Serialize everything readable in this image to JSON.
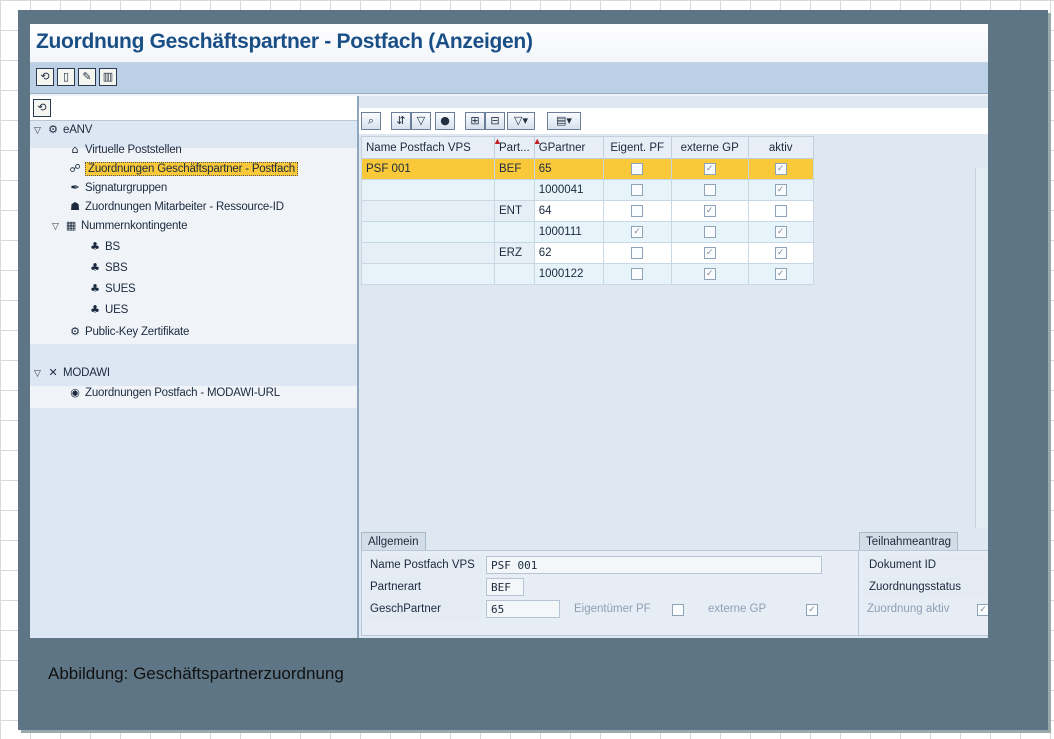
{
  "window": {
    "title": "Zuordnung Geschäftspartner - Postfach (Anzeigen)"
  },
  "caption": "Abbildung: Geschäftspartnerzuordnung",
  "tree": {
    "root": "eANV",
    "items": [
      "Virtuelle Poststellen",
      "Zuordnungen Geschäftspartner - Postfach",
      "Signaturgruppen",
      "Zuordnungen Mitarbeiter - Ressource-ID",
      "Nummernkontingente",
      "BS",
      "SBS",
      "SUES",
      "UES",
      "Public-Key Zertifikate"
    ],
    "root2": "MODAWI",
    "items2": [
      "Zuordnungen Postfach - MODAWI-URL"
    ]
  },
  "grid": {
    "columns": [
      "Name Postfach VPS",
      "Part...",
      "GPartner",
      "Eigent. PF",
      "externe GP",
      "aktiv"
    ],
    "rows": [
      {
        "postfach": "PSF 001",
        "part": "BEF",
        "gpartner": "65",
        "eigent": false,
        "extern": true,
        "aktiv": true
      },
      {
        "postfach": "",
        "part": "",
        "gpartner": "1000041",
        "eigent": false,
        "extern": false,
        "aktiv": true
      },
      {
        "postfach": "",
        "part": "ENT",
        "gpartner": "64",
        "eigent": false,
        "extern": true,
        "aktiv": false
      },
      {
        "postfach": "",
        "part": "",
        "gpartner": "1000111",
        "eigent": true,
        "extern": false,
        "aktiv": true
      },
      {
        "postfach": "",
        "part": "ERZ",
        "gpartner": "62",
        "eigent": false,
        "extern": true,
        "aktiv": true
      },
      {
        "postfach": "",
        "part": "",
        "gpartner": "1000122",
        "eigent": false,
        "extern": true,
        "aktiv": true
      }
    ]
  },
  "detail": {
    "tab": "Allgemein",
    "name_postfach_label": "Name Postfach VPS",
    "name_postfach_value": "PSF 001",
    "partnerart_label": "Partnerart",
    "partnerart_value": "BEF",
    "geschpartner_label": "GeschPartner",
    "geschpartner_value": "65",
    "eigentuemer_label": "Eigentümer PF",
    "extern_label": "externe GP"
  },
  "teilnahme": {
    "tab": "Teilnahmeantrag",
    "dokument_label": "Dokument ID",
    "status_label": "Zuordnungsstatus",
    "aktiv_label": "Zuordnung aktiv"
  }
}
